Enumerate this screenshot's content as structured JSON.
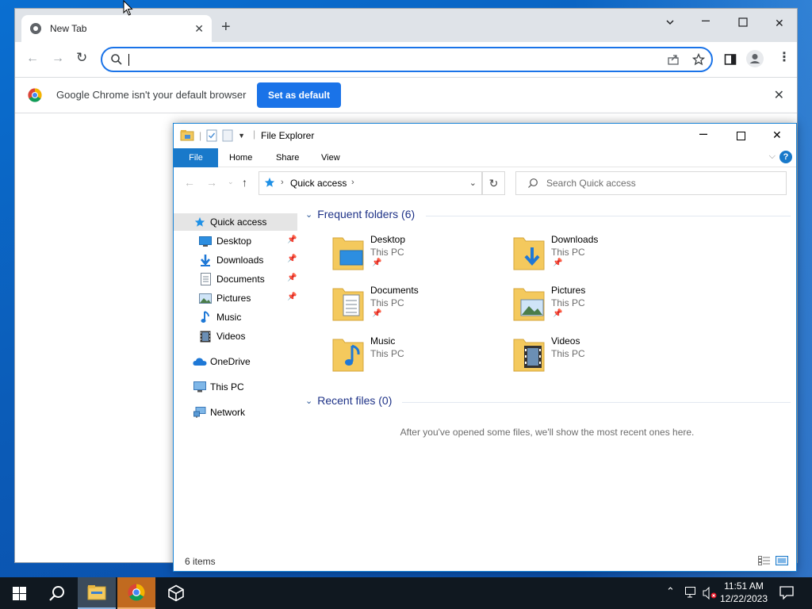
{
  "chrome": {
    "tab_title": "New Tab",
    "new_tab_symbol": "+",
    "omnibox_value": "",
    "infobar_message": "Google Chrome isn't your default browser",
    "infobar_button": "Set as default"
  },
  "explorer": {
    "title": "File Explorer",
    "ribbon_tabs": [
      "File",
      "Home",
      "Share",
      "View"
    ],
    "address": {
      "location": "Quick access"
    },
    "search_placeholder": "Search Quick access",
    "nav": {
      "quick_access": "Quick access",
      "items": [
        {
          "label": "Desktop",
          "pinned": true
        },
        {
          "label": "Downloads",
          "pinned": true
        },
        {
          "label": "Documents",
          "pinned": true
        },
        {
          "label": "Pictures",
          "pinned": true
        },
        {
          "label": "Music",
          "pinned": false
        },
        {
          "label": "Videos",
          "pinned": false
        }
      ],
      "onedrive": "OneDrive",
      "this_pc": "This PC",
      "network": "Network"
    },
    "frequent_folders_header": "Frequent folders (6)",
    "folders": [
      {
        "name": "Desktop",
        "location": "This PC",
        "pinned": true,
        "icon": "desktop-folder-icon"
      },
      {
        "name": "Downloads",
        "location": "This PC",
        "pinned": true,
        "icon": "downloads-folder-icon"
      },
      {
        "name": "Documents",
        "location": "This PC",
        "pinned": true,
        "icon": "documents-folder-icon"
      },
      {
        "name": "Pictures",
        "location": "This PC",
        "pinned": true,
        "icon": "pictures-folder-icon"
      },
      {
        "name": "Music",
        "location": "This PC",
        "pinned": false,
        "icon": "music-folder-icon"
      },
      {
        "name": "Videos",
        "location": "This PC",
        "pinned": false,
        "icon": "videos-folder-icon"
      }
    ],
    "recent_files_header": "Recent files (0)",
    "recent_empty_message": "After you've opened some files, we'll show the most recent ones here.",
    "status_items": "6 items"
  },
  "taskbar": {
    "time": "11:51 AM",
    "date": "12/22/2023"
  },
  "colors": {
    "desktop": "#0b5cb8",
    "chrome_accent": "#1a73e8",
    "explorer_accent": "#1979ca",
    "taskbar": "#101820",
    "folder_yellow": "#f4c95d"
  }
}
